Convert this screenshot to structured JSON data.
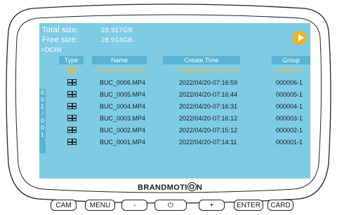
{
  "storage": {
    "total_label": "Total size:",
    "total_value": "28.917GB",
    "free_label": "Free size:",
    "free_value": "28.914GB",
    "path": ">DCIM"
  },
  "table": {
    "headers": [
      "Type",
      "Name",
      "Create Time",
      "Group"
    ],
    "rows": [
      {
        "name": "BUC_0007.MP4",
        "time": "2022/04/20-07:17:08",
        "group": "000007-1",
        "selected": true
      },
      {
        "name": "BUC_0006.MP4",
        "time": "2022/04/20-07:16:59",
        "group": "000006-1",
        "selected": false
      },
      {
        "name": "BUC_0005.MP4",
        "time": "2022/04/20-07:16:44",
        "group": "000005-1",
        "selected": false
      },
      {
        "name": "BUC_0004.MP4",
        "time": "2022/04/20-07:16:31",
        "group": "000004-1",
        "selected": false
      },
      {
        "name": "BUC_0003.MP4",
        "time": "2022/04/20-07:16:12",
        "group": "000003-1",
        "selected": false
      },
      {
        "name": "BUC_0002.MP4",
        "time": "2022/04/20-07:15:12",
        "group": "000002-1",
        "selected": false
      },
      {
        "name": "BUC_0001.MP4",
        "time": "2022/04/20-07:14:11",
        "group": "000001-1",
        "selected": false
      }
    ]
  },
  "pager": {
    "text": "001/001"
  },
  "brand": {
    "prefix": "BRANDMOTI",
    "circled": "O",
    "suffix": "N"
  },
  "buttons": {
    "cam": "CAM",
    "menu": "MENU",
    "minus": "-",
    "power": "⏻",
    "plus": "+",
    "enter": "ENTER",
    "card": "CARD"
  },
  "icons": {
    "play": "play-icon",
    "file": "video-file-icon",
    "power": "power-icon"
  },
  "colors": {
    "screen": "#7ecbe4",
    "header": "#59b3d3",
    "selected": "#f0b838",
    "play": "#f2b321"
  }
}
